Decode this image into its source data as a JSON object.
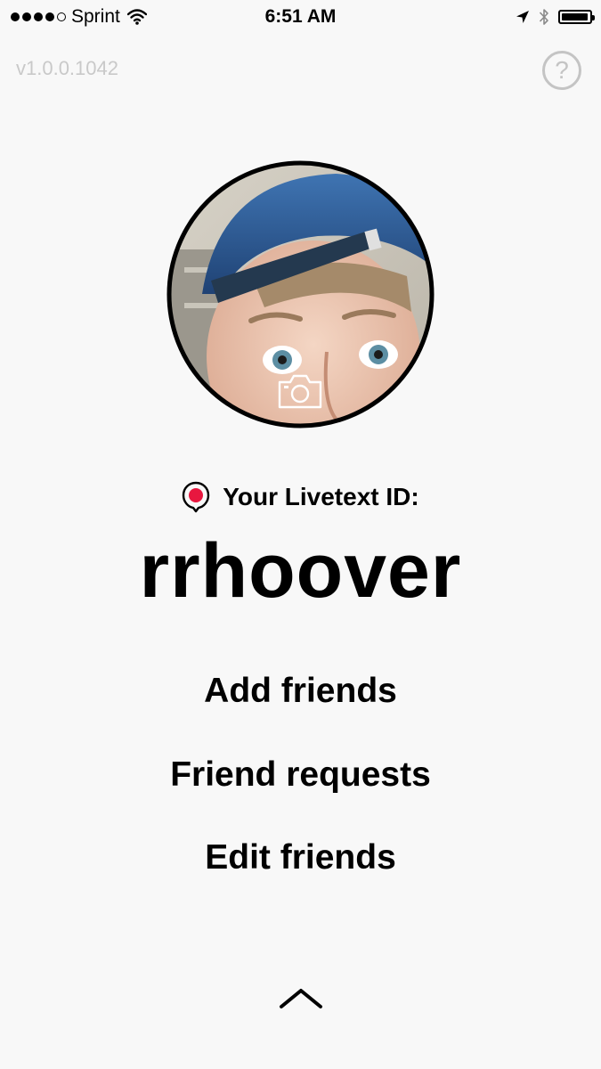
{
  "status_bar": {
    "signal_bars_filled": 4,
    "signal_bars_total": 5,
    "carrier": "Sprint",
    "time": "6:51 AM",
    "battery_level": 0.95,
    "icons": [
      "wifi-icon",
      "location-arrow-icon",
      "bluetooth-icon",
      "battery-icon"
    ]
  },
  "header": {
    "version": "v1.0.0.1042",
    "help_label": "?"
  },
  "profile": {
    "avatar": "profile-photo",
    "camera_icon": "camera-icon",
    "id_label": "Your Livetext ID:",
    "username": "rrhoover"
  },
  "menu": {
    "add_friends": "Add friends",
    "friend_requests": "Friend requests",
    "edit_friends": "Edit friends"
  },
  "footer": {
    "icon": "chevron-up-icon"
  },
  "colors": {
    "background": "#f8f8f8",
    "text": "#000000",
    "muted": "#c9c9c9",
    "accent": "#e8173f"
  }
}
